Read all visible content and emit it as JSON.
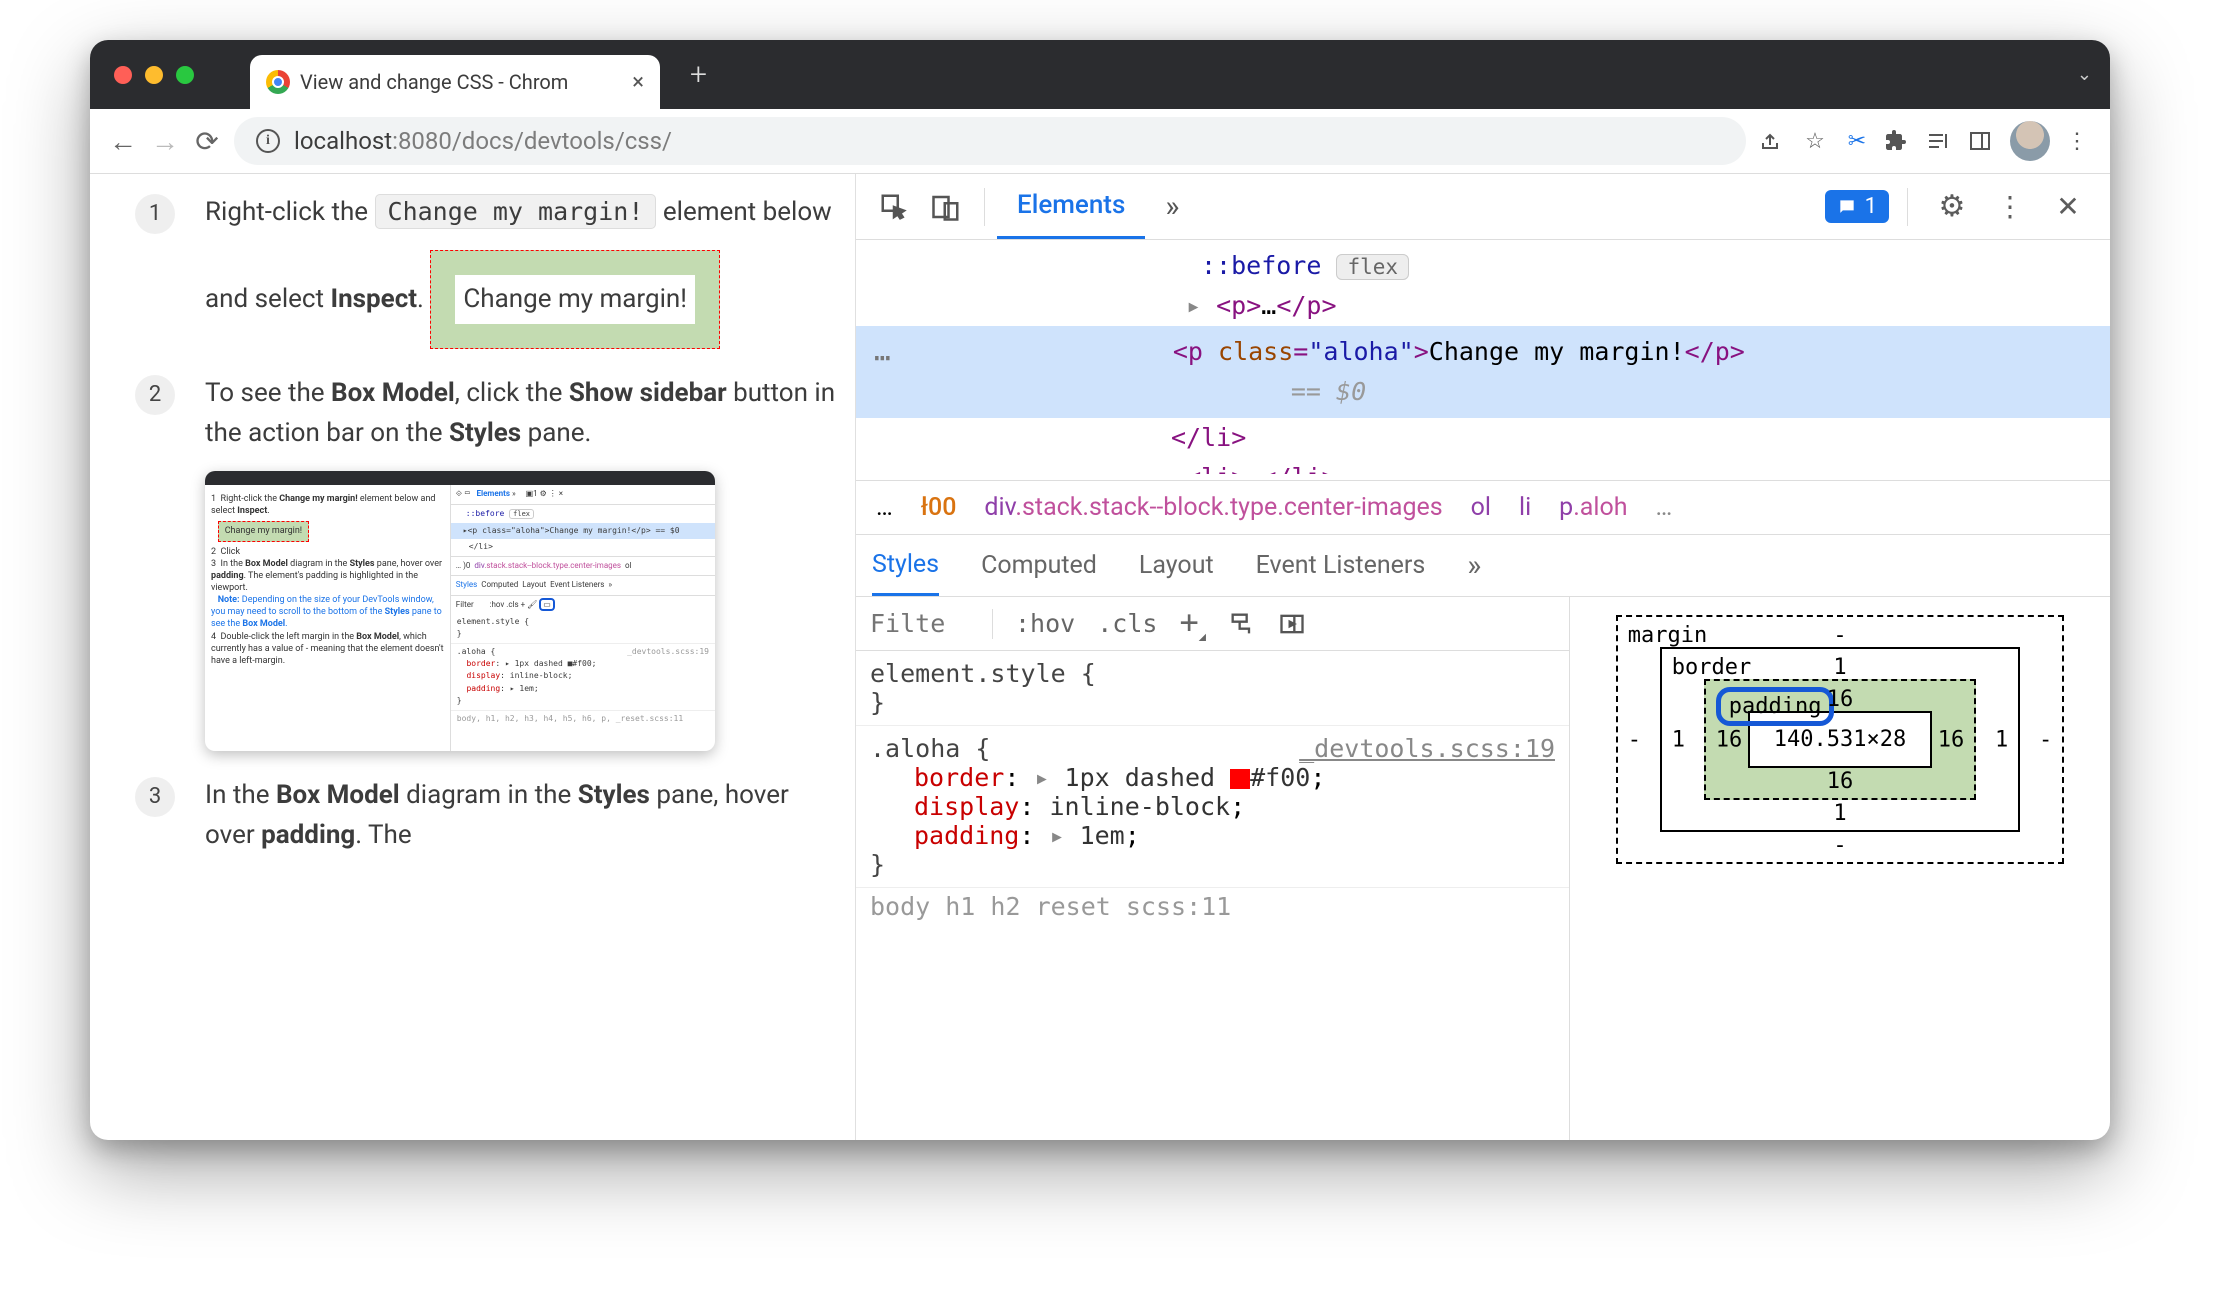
{
  "browser": {
    "tab_title": "View and change CSS - Chrom",
    "url_host": "localhost",
    "url_port": ":8080",
    "url_path": "/docs/devtools/css/"
  },
  "page": {
    "step1_a": "Right-click the ",
    "step1_code": "Change my margin!",
    "step1_b": " element below and select ",
    "step1_c": "Inspect",
    "demo_text": "Change my margin!",
    "step2_a": "To see the ",
    "step2_b": "Box Model",
    "step2_c": ", click the ",
    "step2_d": "Show sidebar",
    "step2_e": " button in the action bar on the ",
    "step2_f": "Styles",
    "step2_g": " pane.",
    "step3_a": "In the ",
    "step3_b": "Box Model",
    "step3_c": " diagram in the ",
    "step3_d": "Styles",
    "step3_e": " pane, hover over ",
    "step3_f": "padding",
    "step3_g": ". The"
  },
  "devtools": {
    "tab_elements": "Elements",
    "more": "»",
    "issues_count": "1",
    "dom": {
      "before": "::before",
      "flex_pill": "flex",
      "p_collapsed_open": "<p>",
      "p_collapsed_mid": "…",
      "p_collapsed_close": "</p>",
      "sel_line": "<p class=\"aloha\">Change my margin!</p>",
      "eq0": "== $0",
      "li_close": "</li>",
      "li_next": "<li>…</li>"
    },
    "crumbs": {
      "dots": "…",
      "t400": "ł00",
      "main": "div.stack.stack--block.type.center-images",
      "ol": "ol",
      "li": "li",
      "p": "p.aloh",
      "end": "…"
    },
    "subtabs": {
      "styles": "Styles",
      "computed": "Computed",
      "layout": "Layout",
      "events": "Event Listeners",
      "more": "»"
    },
    "filter": {
      "placeholder": "Filte",
      "hov": ":hov",
      "cls": ".cls"
    },
    "rules": {
      "element_style": "element.style {",
      "close": "}",
      "aloha_sel": ".aloha {",
      "aloha_src": "_devtools.scss:19",
      "border_p": "border",
      "border_v": "1px dashed ",
      "border_hex": "#f00",
      "display_p": "display",
      "display_v": "inline-block",
      "padding_p": "padding",
      "padding_v": "1em",
      "body_cut": "body  h1  h2             reset scss:11"
    },
    "boxmodel": {
      "margin": "margin",
      "margin_v": "-",
      "border": "border",
      "border_v": "1",
      "padding": "padding",
      "padding_v": "16",
      "content": "140.531×28"
    }
  }
}
